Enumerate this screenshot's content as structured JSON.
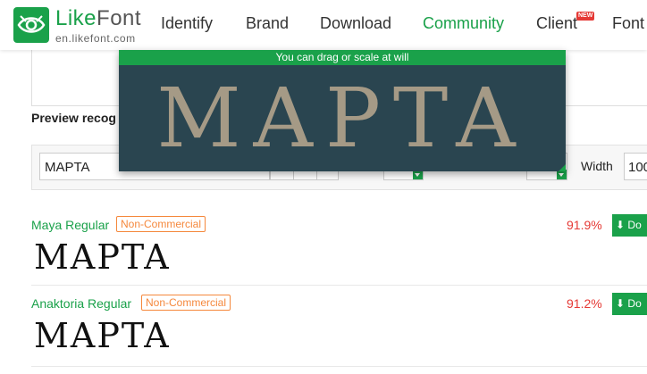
{
  "header": {
    "logo_name_like": "Like",
    "logo_name_font": "Font",
    "logo_domain": "en.likefont.com",
    "nav": [
      {
        "label": "Identify"
      },
      {
        "label": "Brand"
      },
      {
        "label": "Download"
      },
      {
        "label": "Community",
        "active": true
      },
      {
        "label": "Client",
        "badge": "NEW"
      },
      {
        "label": "Font"
      }
    ]
  },
  "preview": {
    "label": "Preview recog"
  },
  "toolbar": {
    "text_value": "MAPTA",
    "width_label": "Width",
    "width_value": "100"
  },
  "popup": {
    "hint": "You can drag or scale at will",
    "sample": "MAPTA"
  },
  "results": [
    {
      "name": "Maya Regular",
      "license": "Non-Commercial",
      "match": "91.9%",
      "download": "Do",
      "sample": "MAPTA"
    },
    {
      "name": "Anaktoria Regular",
      "license": "Non-Commercial",
      "match": "91.2%",
      "download": "Do",
      "sample": "MAPTA"
    }
  ],
  "colors": {
    "brand_green": "#1aa14a",
    "license_orange": "#f5883c",
    "match_red": "#e53935",
    "popup_bg": "#2a4550"
  }
}
